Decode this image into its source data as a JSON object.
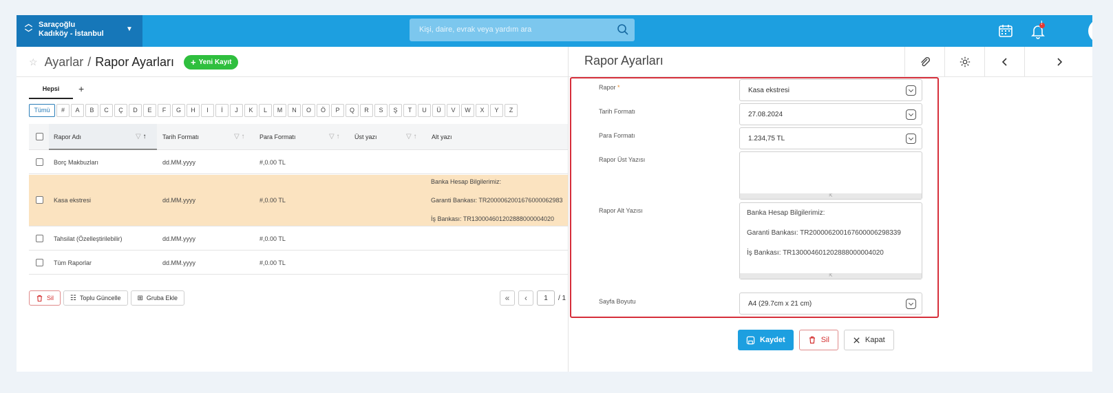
{
  "company": {
    "name": "Saraçoğlu",
    "location": "Kadıköy - İstanbul"
  },
  "search": {
    "placeholder": "Kişi, daire, evrak veya yardım ara"
  },
  "notifications": {
    "badge": "!"
  },
  "breadcrumb": {
    "parent": "Ayarlar",
    "separator": "/",
    "current": "Rapor Ayarları"
  },
  "new_button": "Yeni Kayıt",
  "tabs": {
    "all": "Hepsi",
    "add": "+"
  },
  "letters": [
    "Tümü",
    "#",
    "A",
    "B",
    "C",
    "Ç",
    "D",
    "E",
    "F",
    "G",
    "H",
    "I",
    "İ",
    "J",
    "K",
    "L",
    "M",
    "N",
    "O",
    "Ö",
    "P",
    "Q",
    "R",
    "S",
    "Ş",
    "T",
    "U",
    "Ü",
    "V",
    "W",
    "X",
    "Y",
    "Z"
  ],
  "table": {
    "columns": [
      "Rapor Adı",
      "Tarih Formatı",
      "Para Formatı",
      "Üst yazı",
      "Alt yazı"
    ],
    "rows": [
      {
        "name": "Borç Makbuzları",
        "date": "dd.MM.yyyy",
        "money": "#,0.00 TL",
        "alt": [
          "",
          "",
          ""
        ]
      },
      {
        "name": "Kasa ekstresi",
        "date": "dd.MM.yyyy",
        "money": "#,0.00 TL",
        "alt": [
          "Banka Hesap Bilgilerimiz:",
          "Garanti Bankası: TR2000062001676000062983",
          "İş Bankası: TR13000460120288800000402​0"
        ]
      },
      {
        "name": "Tahsilat (Özelleştirilebilir)",
        "date": "dd.MM.yyyy",
        "money": "#,0.00 TL",
        "alt": [
          "",
          "",
          ""
        ]
      },
      {
        "name": "Tüm Raporlar",
        "date": "dd.MM.yyyy",
        "money": "#,0.00 TL",
        "alt": [
          "",
          "",
          ""
        ]
      }
    ]
  },
  "bottom": {
    "delete": "Sil",
    "bulk_update": "Toplu Güncelle",
    "add_group": "Gruba Ekle"
  },
  "pager": {
    "page": "1",
    "total": "/ 1"
  },
  "panel": {
    "title": "Rapor Ayarları",
    "fields": {
      "report_label": "Rapor",
      "report_required": "*",
      "report_value": "Kasa ekstresi",
      "date_label": "Tarih Formatı",
      "date_value": "27.08.2024",
      "money_label": "Para Formatı",
      "money_value": "1.234,75 TL",
      "header_label": "Rapor Üst Yazısı",
      "header_value": "",
      "footer_label": "Rapor Alt Yazısı",
      "footer_lines": [
        "Banka Hesap Bilgilerimiz:",
        "Garanti Bankası: TR200006200167600006298339",
        "İş Bankası: TR130004601202888000004020"
      ],
      "page_label": "Sayfa Boyutu",
      "page_value": "A4 (29.7cm x 21 cm)"
    },
    "actions": {
      "save": "Kaydet",
      "delete": "Sil",
      "close": "Kapat"
    }
  },
  "colors": {
    "topbar": "#1d9fe0",
    "company_bg": "#1677b9",
    "selected_row": "#fbe3c0",
    "highlight_border": "#d62e3a",
    "new_button": "#2fbf3e"
  }
}
